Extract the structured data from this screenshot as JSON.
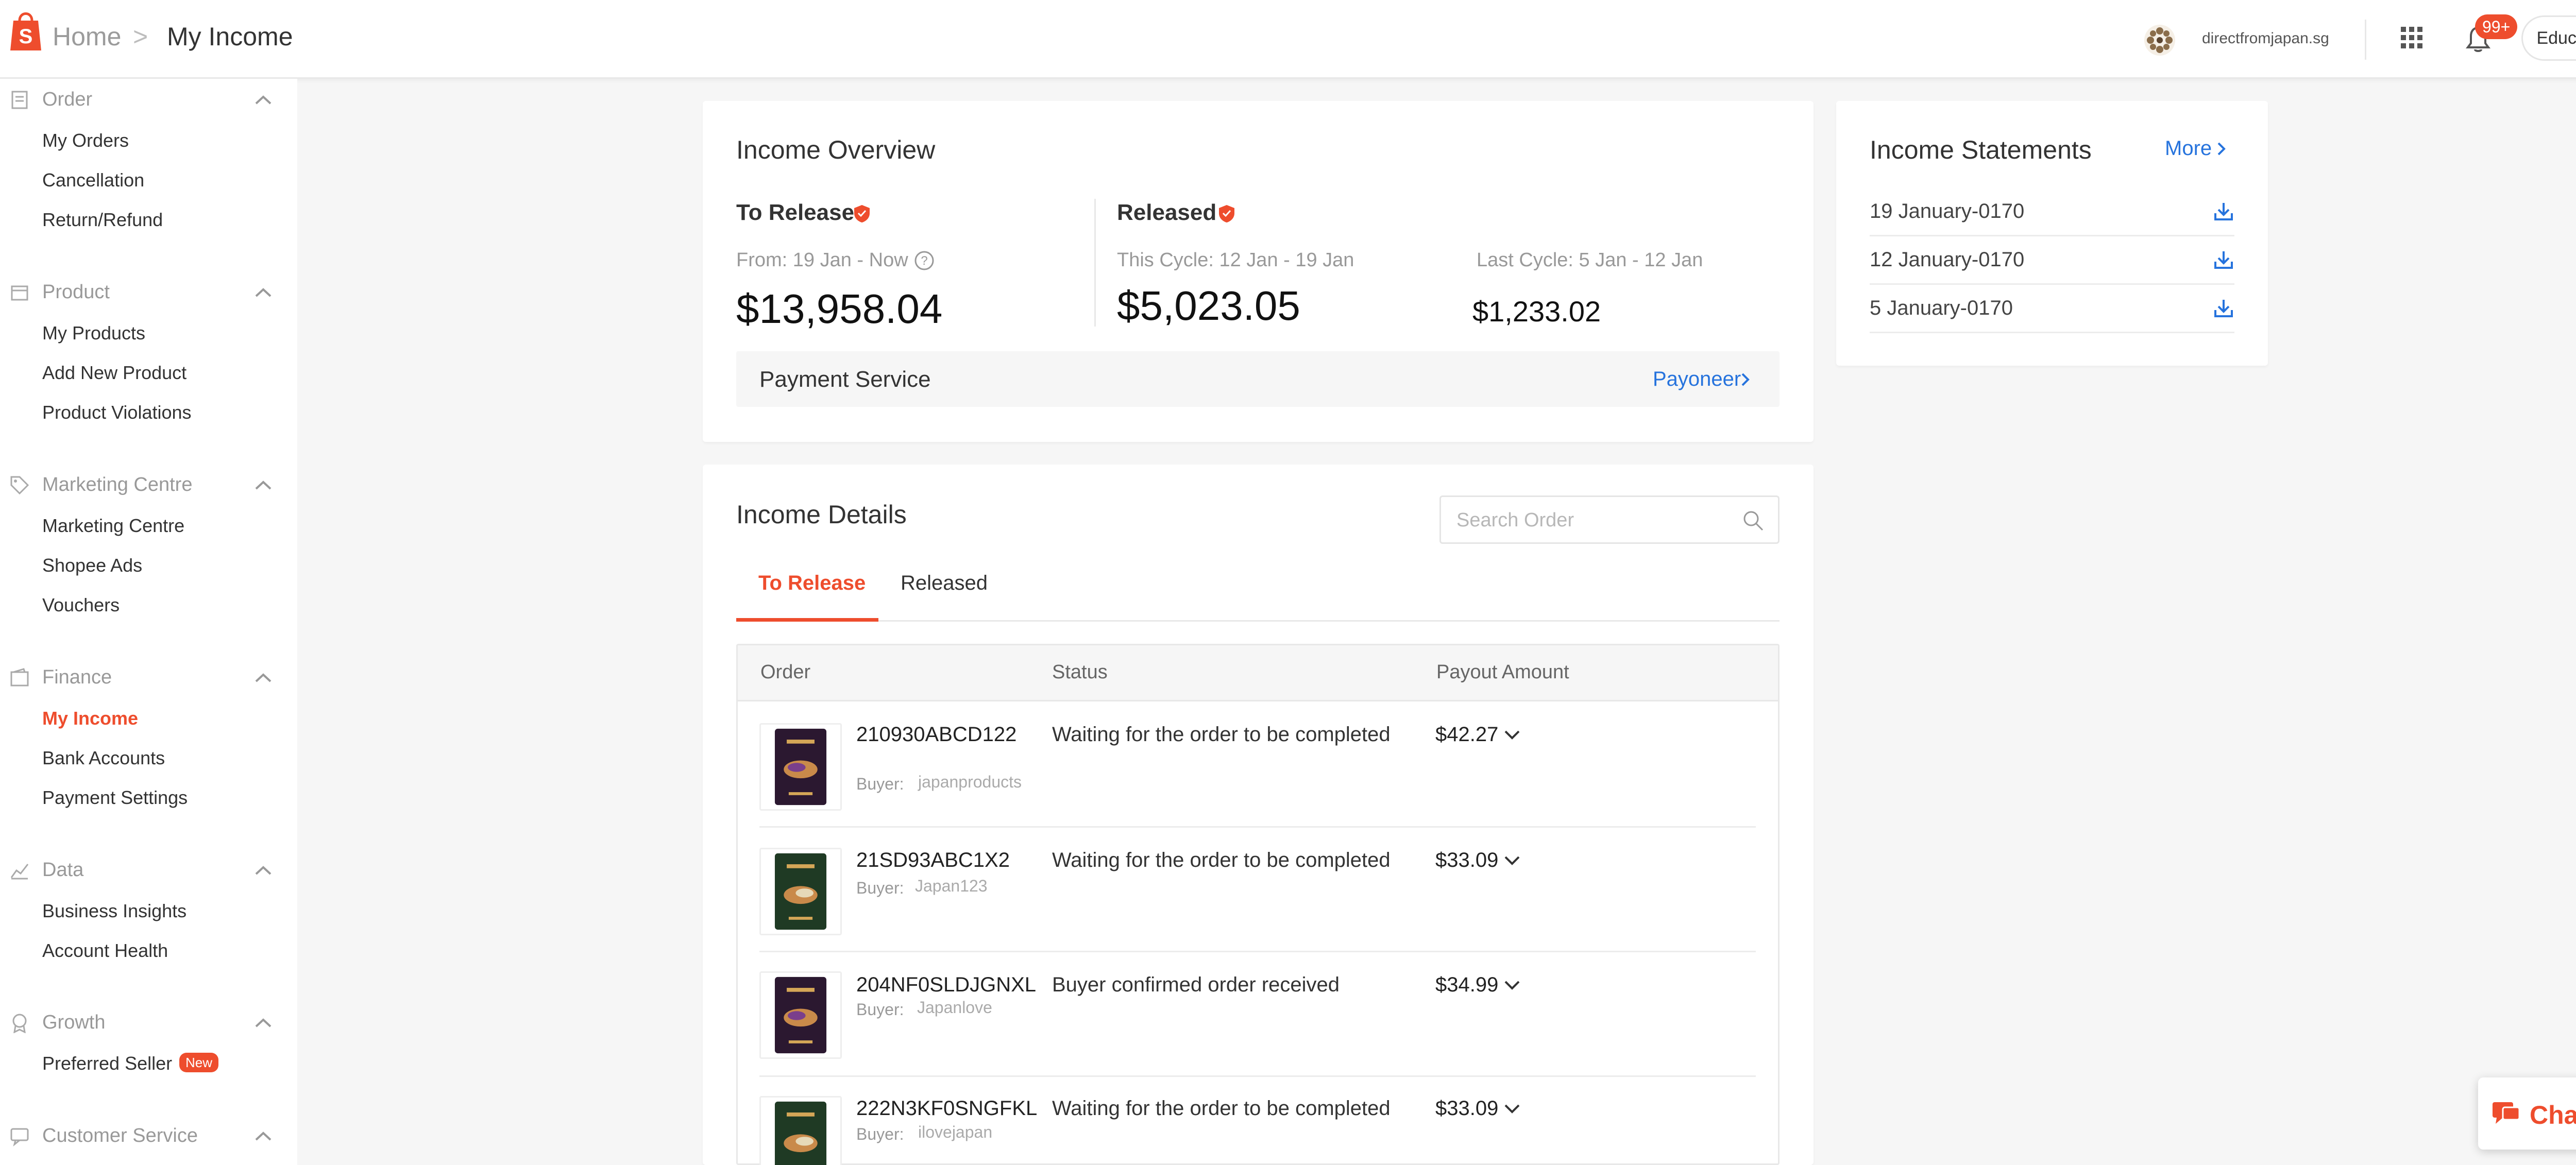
{
  "colors": {
    "brand": "#ee4d2d",
    "link": "#2673dd",
    "background": "#f6f6f6"
  },
  "header": {
    "breadcrumb_home": "Home",
    "breadcrumb_current": "My Income",
    "shop_name": "directfromjapan.sg",
    "notification_badge": "99+",
    "education_hub": "Education Hub"
  },
  "sidebar": {
    "sections": [
      {
        "title": "Order",
        "icon": "clipboard-icon",
        "items": [
          "My Orders",
          "Cancellation",
          "Return/Refund"
        ]
      },
      {
        "title": "Product",
        "icon": "box-icon",
        "items": [
          "My Products",
          "Add New Product",
          "Product Violations"
        ]
      },
      {
        "title": "Marketing Centre",
        "icon": "tag-icon",
        "items": [
          "Marketing Centre",
          "Shopee Ads",
          "Vouchers"
        ]
      },
      {
        "title": "Finance",
        "icon": "wallet-icon",
        "items": [
          "My Income",
          "Bank Accounts",
          "Payment Settings"
        ]
      },
      {
        "title": "Data",
        "icon": "chart-icon",
        "items": [
          "Business Insights",
          "Account Health"
        ]
      },
      {
        "title": "Growth",
        "icon": "medal-icon",
        "items": [
          "Preferred Seller"
        ]
      },
      {
        "title": "Customer Service",
        "icon": "chat-bubble-icon",
        "items": []
      }
    ],
    "active_item": "My Income",
    "new_badge": "New"
  },
  "overview": {
    "title": "Income Overview",
    "to_release": {
      "label": "To Release",
      "period": "From: 19 Jan - Now",
      "amount": "$13,958.04"
    },
    "released": {
      "label": "Released",
      "this_cycle_label": "This Cycle: 12 Jan - 19 Jan",
      "this_cycle_amount": "$5,023.05",
      "last_cycle_label": "Last Cycle: 5 Jan - 12 Jan",
      "last_cycle_amount": "$1,233.02"
    },
    "payment_service_label": "Payment Service",
    "payment_service_value": "Payoneer"
  },
  "details": {
    "title": "Income Details",
    "search_placeholder": "Search Order",
    "tabs": [
      "To Release",
      "Released"
    ],
    "active_tab": "To Release",
    "columns": [
      "Order",
      "Status",
      "Payout Amount"
    ],
    "buyer_label": "Buyer:",
    "rows": [
      {
        "order": "210930ABCD122",
        "buyer": "japanproducts",
        "status": "Waiting for the order to be completed",
        "amount": "$42.27",
        "package": "purple"
      },
      {
        "order": "21SD93ABC1X2",
        "buyer": "Japan123",
        "status": "Waiting for the order to be completed",
        "amount": "$33.09",
        "package": "green"
      },
      {
        "order": "204NF0SLDJGNXL",
        "buyer": "Japanlove",
        "status": "Buyer confirmed order received",
        "amount": "$34.99",
        "package": "purple"
      },
      {
        "order": "222N3KF0SNGFKL",
        "buyer": "ilovejapan",
        "status": "Waiting for the order to be completed",
        "amount": "$33.09",
        "package": "green"
      }
    ]
  },
  "statements": {
    "title": "Income Statements",
    "more": "More",
    "items": [
      "19 January-0170",
      "12 January-0170",
      "5 January-0170"
    ]
  },
  "chat": {
    "label": "Chat"
  }
}
